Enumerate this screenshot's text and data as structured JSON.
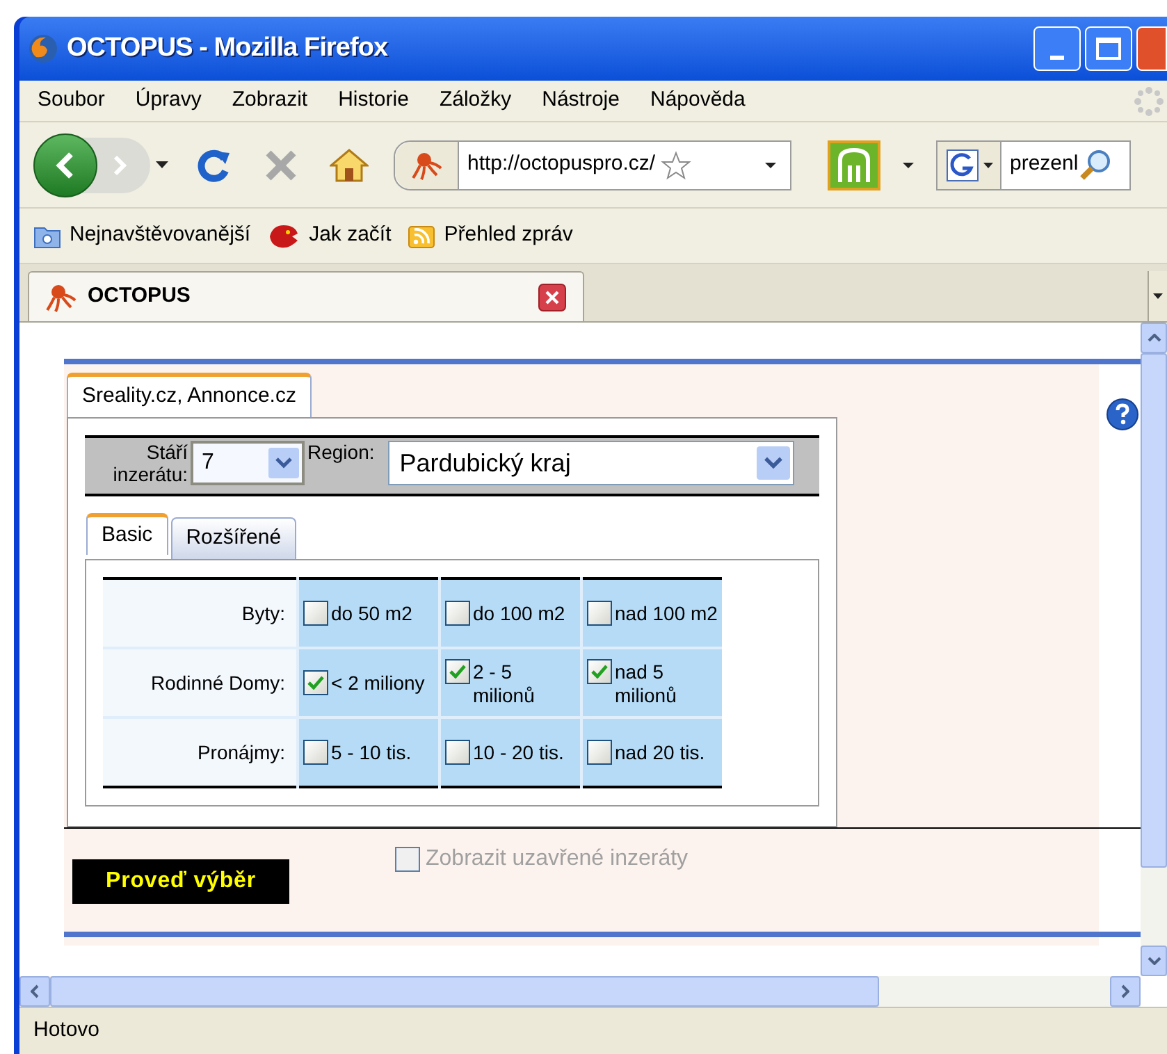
{
  "window": {
    "title": "OCTOPUS - Mozilla Firefox"
  },
  "menu": [
    "Soubor",
    "Úpravy",
    "Zobrazit",
    "Historie",
    "Záložky",
    "Nástroje",
    "Nápověda"
  ],
  "toolbar": {
    "url": "http://octopuspro.cz/",
    "search": "prezenl"
  },
  "bookmarks": [
    "Nejnavštěvovanější",
    "Jak začít",
    "Přehled zpráv"
  ],
  "tabs": [
    {
      "label": "OCTOPUS",
      "selected": true
    }
  ],
  "page": {
    "tabs": [
      {
        "label": "Sreality.cz, Annonce.cz",
        "selected": true
      }
    ],
    "age": {
      "label": "Stáří inzerátu:",
      "value": "7"
    },
    "region": {
      "label": "Region:",
      "value": "Pardubický kraj"
    },
    "subtabs": [
      {
        "label": "Basic",
        "selected": true
      },
      {
        "label": "Rozšířené",
        "selected": false
      }
    ],
    "rows": [
      {
        "label": "Byty:",
        "options": [
          {
            "label": "do 50 m2",
            "checked": false
          },
          {
            "label": "do 100 m2",
            "checked": false
          },
          {
            "label": "nad 100 m2",
            "checked": false
          }
        ]
      },
      {
        "label": "Rodinné Domy:",
        "options": [
          {
            "label": "< 2 miliony",
            "checked": true
          },
          {
            "label": "2 - 5 milionů",
            "checked": true
          },
          {
            "label": "nad 5 milionů",
            "checked": true
          }
        ]
      },
      {
        "label": "Pronájmy:",
        "options": [
          {
            "label": "5 - 10 tis.",
            "checked": false
          },
          {
            "label": "10 - 20 tis.",
            "checked": false
          },
          {
            "label": "nad 20 tis.",
            "checked": false
          }
        ]
      }
    ],
    "show_closed": {
      "label": "Zobrazit uzavřené inzeráty",
      "checked": false,
      "disabled": true
    },
    "submit": "Proveď výběr"
  },
  "status_bar": "Hotovo"
}
